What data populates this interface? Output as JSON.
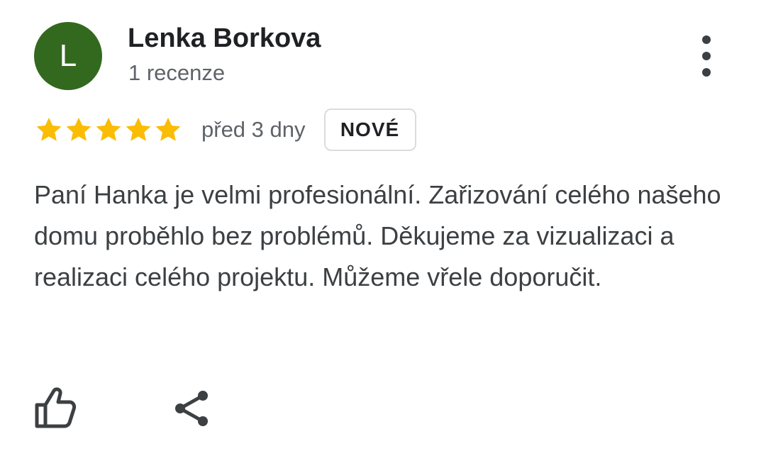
{
  "review": {
    "author": {
      "initial": "L",
      "name": "Lenka Borkova",
      "review_count": "1 recenze",
      "avatar_color": "#33691e"
    },
    "rating": {
      "stars": 5,
      "max_stars": 5,
      "star_color": "#fbbc04"
    },
    "date": "před 3 dny",
    "badge": "NOVÉ",
    "text": "Paní Hanka je velmi profesionální. Zařizování celého našeho domu proběhlo bez problémů. Děkujeme za vizualizaci a realizaci celého projektu. Můžeme vřele doporučit.",
    "actions": {
      "like_icon": "thumb-up-icon",
      "share_icon": "share-icon",
      "more_icon": "more-vert-icon"
    }
  }
}
